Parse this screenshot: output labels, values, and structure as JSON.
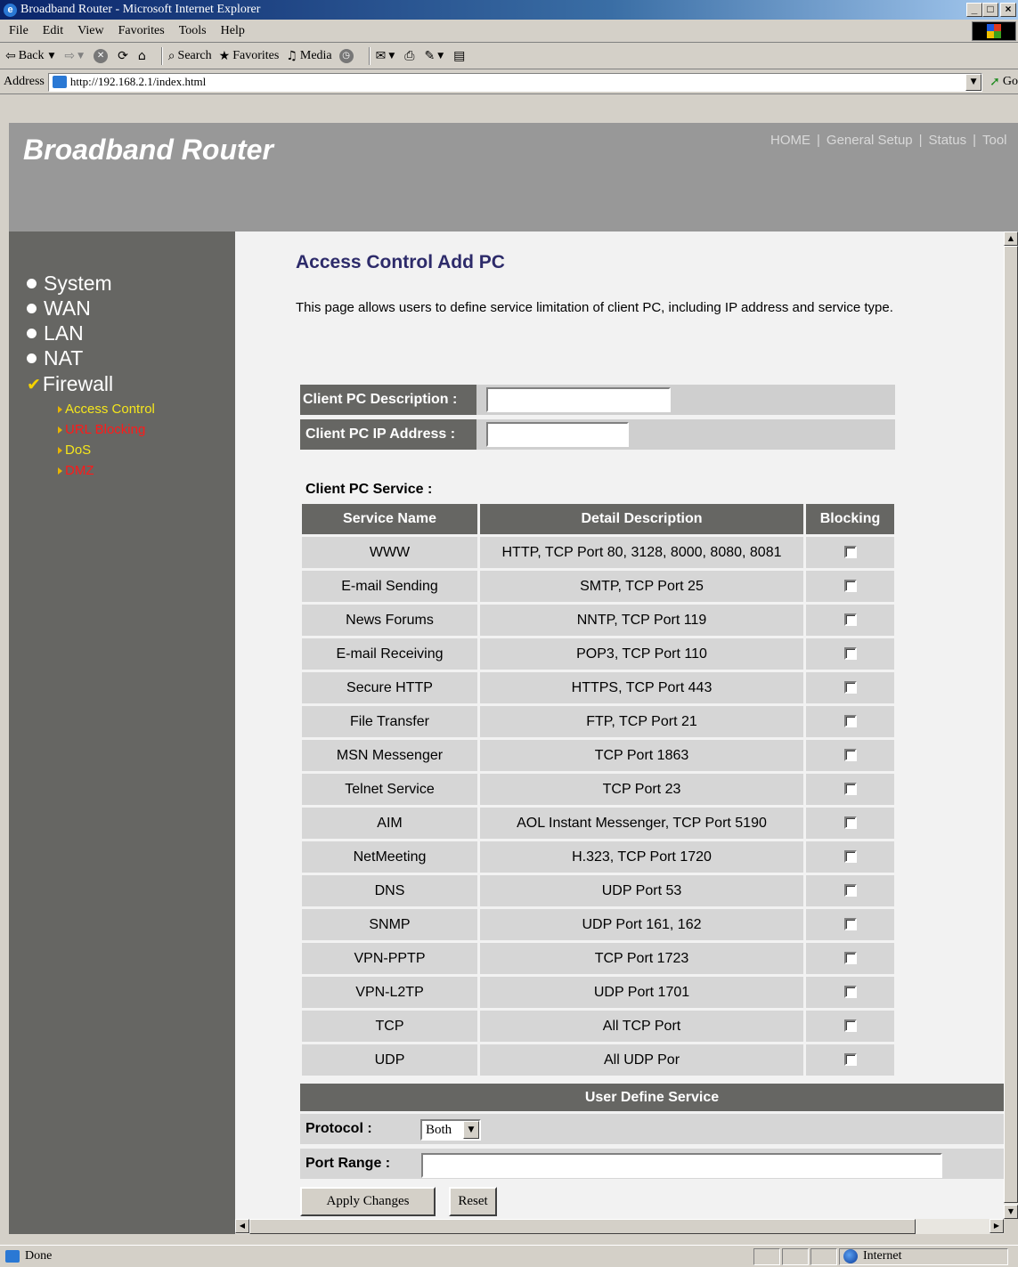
{
  "window": {
    "title": "Broadband Router - Microsoft Internet Explorer"
  },
  "menubar": [
    "File",
    "Edit",
    "View",
    "Favorites",
    "Tools",
    "Help"
  ],
  "toolbar": {
    "back": "Back",
    "search": "Search",
    "favorites": "Favorites",
    "media": "Media"
  },
  "address": {
    "label": "Address",
    "url": "http://192.168.2.1/index.html",
    "go": "Go"
  },
  "banner": {
    "brand": "Broadband Router"
  },
  "topnav": [
    "HOME",
    "General Setup",
    "Status",
    "Tool"
  ],
  "leftnav": {
    "main": [
      "System",
      "WAN",
      "LAN",
      "NAT",
      "Firewall"
    ],
    "sub": [
      "Access Control",
      "URL Blocking",
      "DoS",
      "DMZ"
    ]
  },
  "page": {
    "title": "Access Control Add PC",
    "description": "This page allows users to define service limitation of client PC, including IP address and service type."
  },
  "form": {
    "description_label": "Client PC Description :",
    "description_value": "",
    "ip_label": "Client PC IP Address :",
    "ip_value": ""
  },
  "service": {
    "section_label": "Client PC Service :",
    "headers": [
      "Service Name",
      "Detail Description",
      "Blocking"
    ],
    "rows": [
      {
        "name": "WWW",
        "detail": "HTTP, TCP Port 80, 3128, 8000, 8080, 8081"
      },
      {
        "name": "E-mail Sending",
        "detail": "SMTP, TCP Port 25"
      },
      {
        "name": "News Forums",
        "detail": "NNTP, TCP Port 119"
      },
      {
        "name": "E-mail Receiving",
        "detail": "POP3, TCP Port 110"
      },
      {
        "name": "Secure HTTP",
        "detail": "HTTPS, TCP Port 443"
      },
      {
        "name": "File Transfer",
        "detail": "FTP, TCP Port 21"
      },
      {
        "name": "MSN Messenger",
        "detail": "TCP Port 1863"
      },
      {
        "name": "Telnet Service",
        "detail": "TCP Port 23"
      },
      {
        "name": "AIM",
        "detail": "AOL Instant Messenger, TCP Port 5190"
      },
      {
        "name": "NetMeeting",
        "detail": "H.323, TCP Port 1720"
      },
      {
        "name": "DNS",
        "detail": "UDP Port 53"
      },
      {
        "name": "SNMP",
        "detail": "UDP Port 161, 162"
      },
      {
        "name": "VPN-PPTP",
        "detail": "TCP Port 1723"
      },
      {
        "name": "VPN-L2TP",
        "detail": "UDP Port 1701"
      },
      {
        "name": "TCP",
        "detail": "All TCP Port"
      },
      {
        "name": "UDP",
        "detail": "All UDP Por"
      }
    ]
  },
  "user_define": {
    "header": "User Define Service",
    "protocol_label": "Protocol :",
    "protocol_value": "Both",
    "port_label": "Port Range :",
    "port_value": ""
  },
  "buttons": {
    "apply": "Apply Changes",
    "reset": "Reset"
  },
  "statusbar": {
    "status": "Done",
    "zone": "Internet"
  }
}
